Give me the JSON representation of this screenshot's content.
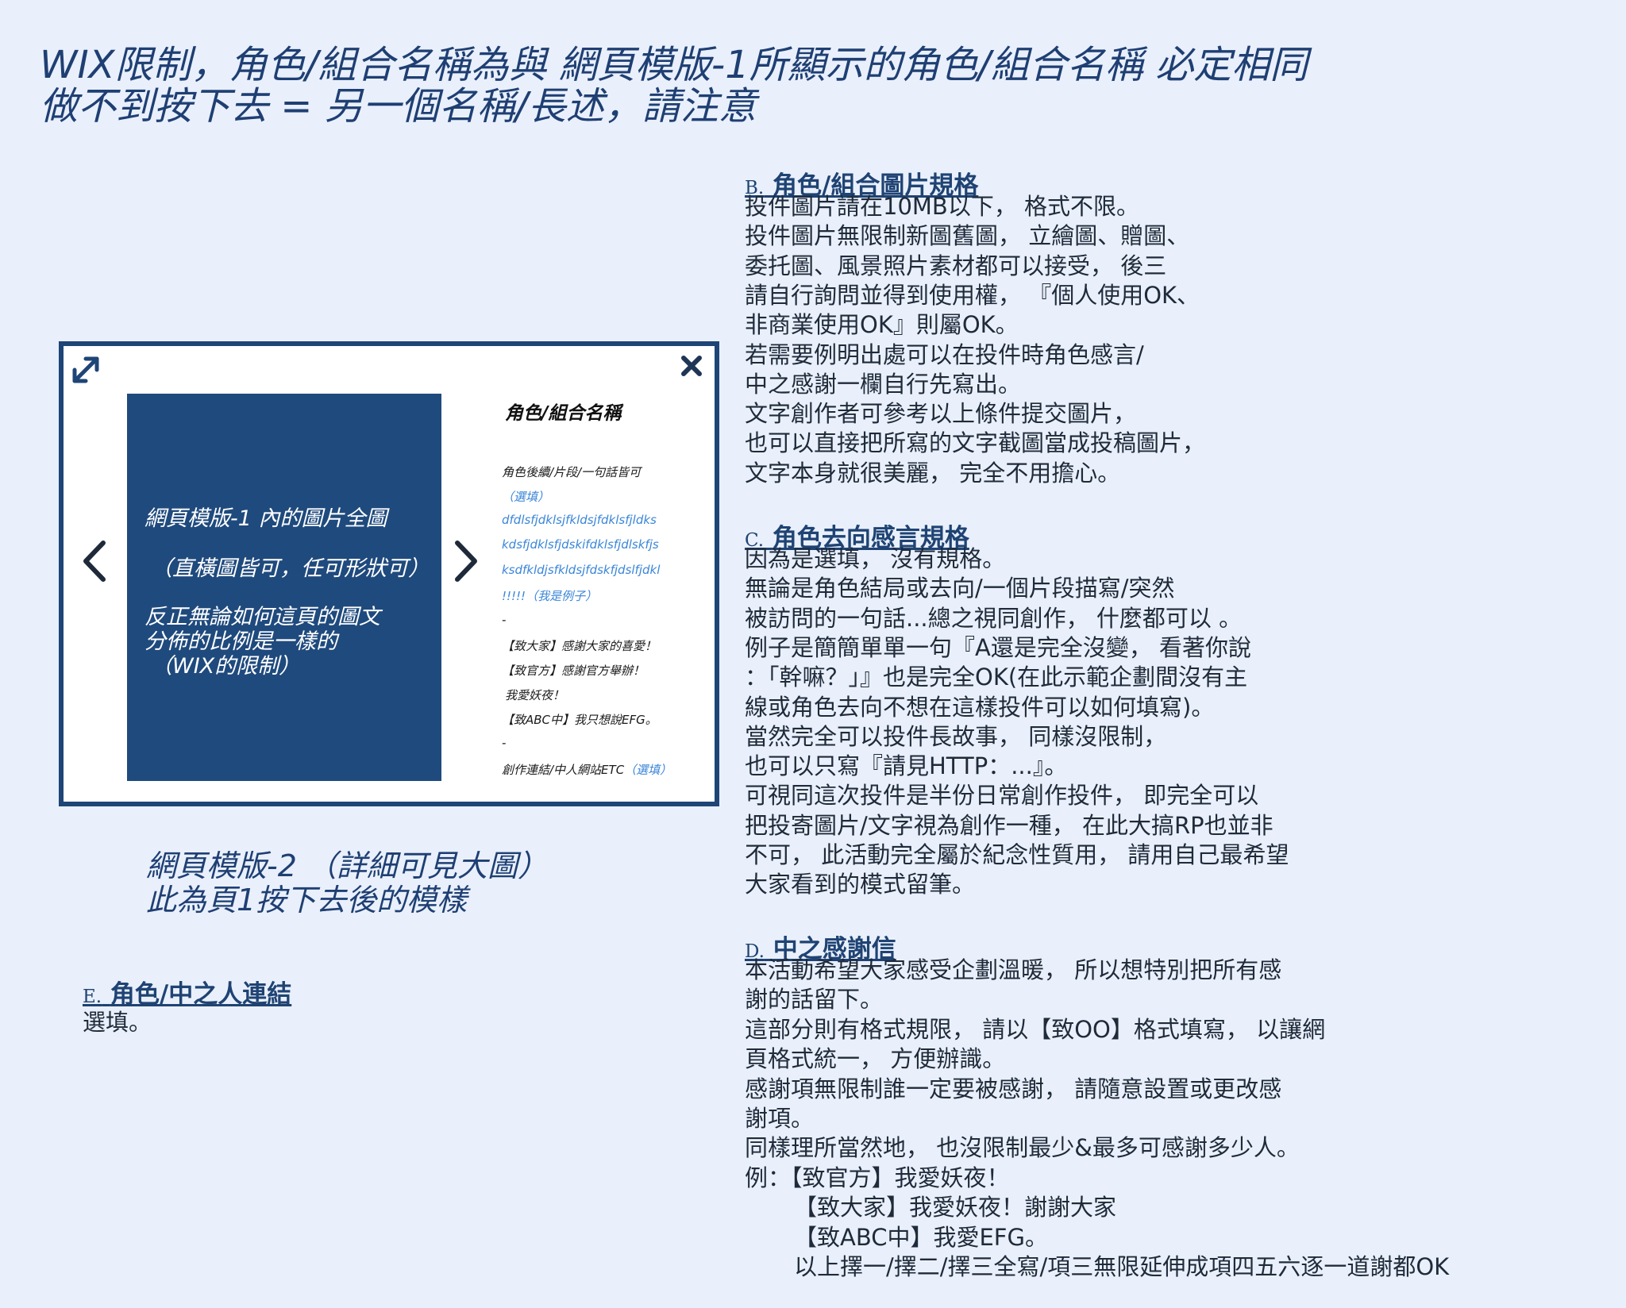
{
  "header": {
    "line1": "WIX限制，角色/組合名稱為與 網頁模版-1所顯示的角色/組合名稱 必定相同",
    "line2": "做不到按下去 = 另一個名稱/長述，請注意"
  },
  "modal": {
    "gallery": {
      "line1": "網頁模版-1 內的圖片全圖",
      "line2": "（直橫圖皆可，任可形狀可）",
      "line3": "反正無論如何這頁的圖文",
      "line4": "分佈的比例是一樣的",
      "line5": "（WIX的限制）"
    },
    "panel": {
      "title": "角色/組合名稱",
      "lines": [
        {
          "text": "角色後續/片段/一句話皆可",
          "blue": false
        },
        {
          "text": "（選填）",
          "blue": true
        },
        {
          "text": "dfdlsfjdklsjfkldsjfdklsfjldks",
          "blue": true
        },
        {
          "text": "kdsfjdklsfjdskifdklsfjdlskfjs",
          "blue": true
        },
        {
          "text": "ksdfkldjsfkldsjfdskfjdslfjdkl",
          "blue": true
        },
        {
          "text": "!!!!!（我是例子）",
          "blue": true
        },
        {
          "text": "-",
          "blue": false
        },
        {
          "text": "【致大家】感謝大家的喜愛！",
          "blue": false
        },
        {
          "text": "【致官方】感謝官方舉辦！",
          "blue": false
        },
        {
          "text": "我愛妖夜！",
          "blue": false
        },
        {
          "text": "【致ABC中】我只想說EFG。",
          "blue": false
        },
        {
          "text": "-",
          "blue": false
        }
      ],
      "last_line": "創作連結/中人網站ETC",
      "last_line_suffix": "（選填）"
    }
  },
  "caption": {
    "line1": "網頁模版-2 （詳細可見大圖）",
    "line2": "此為頁1按下去後的模樣"
  },
  "section_e": {
    "letter": "E.",
    "title": "角色/中之人連結",
    "lines": [
      "選填。"
    ]
  },
  "section_b": {
    "letter": "B.",
    "title": "角色/組合圖片規格",
    "lines": [
      "投件圖片請在10MB以下， 格式不限。",
      "投件圖片無限制新圖舊圖， 立繪圖、贈圖、",
      "委托圖、風景照片素材都可以接受， 後三",
      "請自行詢問並得到使用權， 『個人使用OK、",
      "非商業使用OK』則屬OK。",
      "若需要例明出處可以在投件時角色感言/",
      "中之感謝一欄自行先寫出。",
      "文字創作者可參考以上條件提交圖片，",
      "也可以直接把所寫的文字截圖當成投稿圖片，",
      "文字本身就很美麗， 完全不用擔心。"
    ]
  },
  "section_c": {
    "letter": "C.",
    "title": "角色去向感言規格",
    "lines": [
      "因為是選填， 沒有規格。",
      "無論是角色結局或去向/一個片段描寫/突然",
      "被訪問的一句話...總之視同創作， 什麼都可以 。",
      "例子是簡簡單單一句『A還是完全沒變， 看著你說",
      "：「幹嘛？」』也是完全OK(在此示範企劃間沒有主",
      "線或角色去向不想在這樣投件可以如何填寫)。",
      "當然完全可以投件長故事， 同樣沒限制，",
      "也可以只寫『請見HTTP：...』。",
      "可視同這次投件是半份日常創作投件， 即完全可以",
      "把投寄圖片/文字視為創作一種， 在此大搞RP也並非",
      "不可， 此活動完全屬於紀念性質用， 請用自己最希望",
      "大家看到的模式留筆。"
    ]
  },
  "section_d": {
    "letter": "D.",
    "title": "中之感謝信",
    "lines": [
      "本活動希望大家感受企劃溫暖， 所以想特別把所有感",
      "謝的話留下。",
      "這部分則有格式規限， 請以【致OO】格式填寫， 以讓網",
      "頁格式統一， 方便辦識。",
      "感謝項無限制誰一定要被感謝， 請隨意設置或更改感",
      "謝項。",
      "同樣理所當然地， 也沒限制最少&最多可感謝多少人。",
      "例：【致官方】我愛妖夜！",
      "【致大家】我愛妖夜！謝謝大家",
      "【致ABC中】我愛EFG。",
      "以上擇一/擇二/擇三全寫/項三無限延伸成項四五六逐一道謝都OK"
    ]
  }
}
